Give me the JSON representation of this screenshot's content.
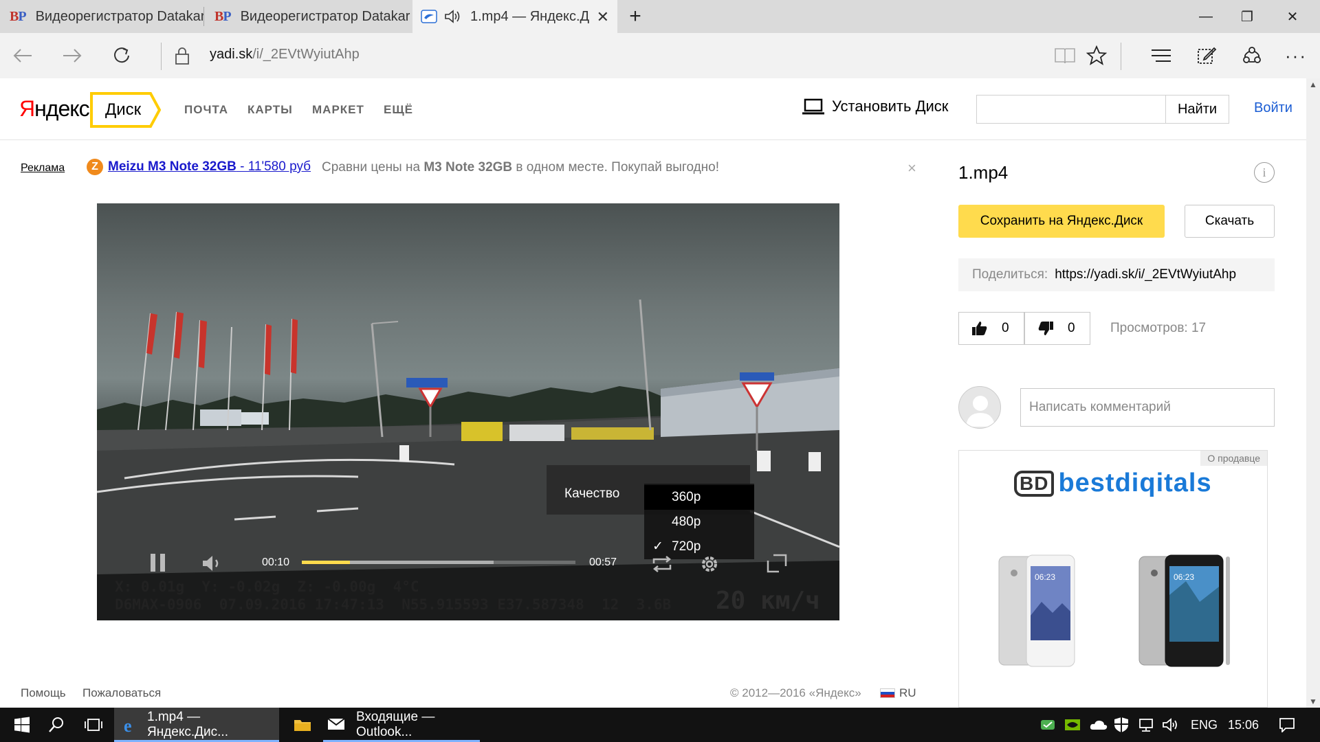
{
  "browser": {
    "tabs": [
      {
        "icon": "bp-favicon",
        "icon_text": [
          "B",
          "P"
        ],
        "title": "Видеорегистратор Datakar"
      },
      {
        "icon": "bp-favicon",
        "icon_text": [
          "B",
          "P"
        ],
        "title": "Видеорегистратор Datakar"
      },
      {
        "icon": "yandex-disk-favicon",
        "title": "1.mp4 — Яндекс.Д",
        "audio": true,
        "active": true
      }
    ],
    "new_tab_glyph": "+",
    "close_glyph": "✕",
    "window_controls": {
      "minimize": "—",
      "restore": "❐",
      "close": "✕"
    },
    "address": {
      "host": "yadi.sk",
      "path": "/i/_2EVtWyiutAhp"
    }
  },
  "site": {
    "logo": {
      "first": "Я",
      "rest": "ндекс"
    },
    "service": "Диск",
    "nav": [
      "ПОЧТА",
      "КАРТЫ",
      "МАРКЕТ",
      "ЕЩЁ"
    ],
    "install_label": "Установить Диск",
    "search": {
      "value": "",
      "button": "Найти"
    },
    "login": "Войти"
  },
  "ad": {
    "label": "Реклама",
    "icon_text": "Z",
    "link_title": "Meizu M3 Note 32GB",
    "link_price": " - 11'580 руб",
    "text_before": "Сравни цены на ",
    "text_bold": "M3 Note 32GB",
    "text_after": " в одном месте. Покупай выгодно!",
    "close": "×"
  },
  "player": {
    "quality_label": "Качество",
    "quality_options": [
      {
        "label": "360p",
        "checked": false,
        "highlighted": true
      },
      {
        "label": "480p",
        "checked": false,
        "highlighted": false
      },
      {
        "label": "720p",
        "checked": true,
        "highlighted": false
      }
    ],
    "check_glyph": "✓",
    "time_current": "00:10",
    "time_total": "00:57",
    "progress_fraction": 0.175,
    "buffered_fraction": 0.7,
    "osd_line1": "X: 0.01g  Y: -0.02g  Z: -0.00g  4°C",
    "osd_line2": "D6MAX-0906  07.09.2016 17:47:13  N55.915593 E37.587348  12  3.6B",
    "osd_speed": "20 км/ч"
  },
  "sidebar": {
    "file_name": "1.mp4",
    "info_glyph": "i",
    "save_button": "Сохранить на Яндекс.Диск",
    "download_button": "Скачать",
    "share_label": "Поделиться:",
    "share_url": "https://yadi.sk/i/_2EVtWyiutAhp",
    "likes": "0",
    "dislikes": "0",
    "views": "Просмотров: 17",
    "comment_placeholder": "Написать комментарий",
    "ad_about": "О продавце",
    "ad_brand_mark": "BD",
    "ad_brand": "bestdiqitals",
    "phone_clock": "06:23"
  },
  "footer": {
    "help": "Помощь",
    "complain": "Пожаловаться",
    "copyright": "© 2012—2016 «Яндекс»",
    "lang": "RU"
  },
  "taskbar": {
    "apps": [
      {
        "icon": "edge-icon",
        "label": "1.mp4 — Яндекс.Дис..."
      },
      {
        "icon": "file-explorer-icon",
        "label": ""
      },
      {
        "icon": "outlook-icon",
        "label": "Входящие — Outlook..."
      }
    ],
    "lang": "ENG",
    "clock": "15:06"
  },
  "colors": {
    "accent_yellow": "#ffdb4d",
    "link_blue": "#1a5cd3",
    "ad_link": "#1a1acc",
    "yandex_red": "#ff0000"
  }
}
